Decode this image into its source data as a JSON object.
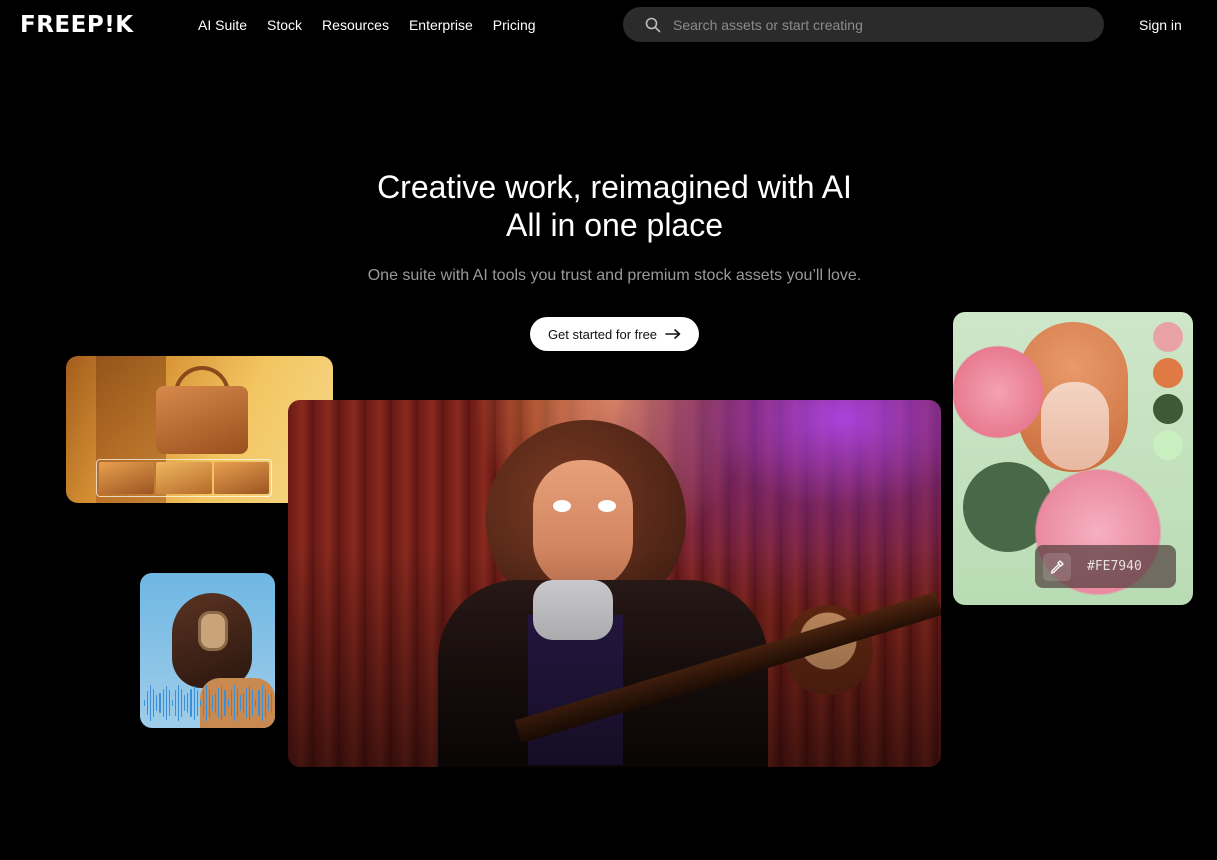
{
  "header": {
    "logo_text": "FREEP!K",
    "nav": [
      "AI Suite",
      "Stock",
      "Resources",
      "Enterprise",
      "Pricing"
    ],
    "search_placeholder": "Search assets or start creating",
    "signin_label": "Sign in"
  },
  "hero": {
    "title_line1": "Creative work, reimagined with AI",
    "title_line2": "All in one place",
    "subtitle": "One suite with AI tools you trust and premium stock assets you’ll love.",
    "cta_label": "Get started for free"
  },
  "color_picker": {
    "hex": "#FE7940",
    "swatches": [
      "#e9a2a8",
      "#e07a44",
      "#3d5a36",
      "#c9efc0"
    ]
  },
  "colors": {
    "background": "#000000",
    "search_bg": "#2b2b2b",
    "cta_bg": "#ffffff",
    "muted_text": "#9a9a9a"
  }
}
